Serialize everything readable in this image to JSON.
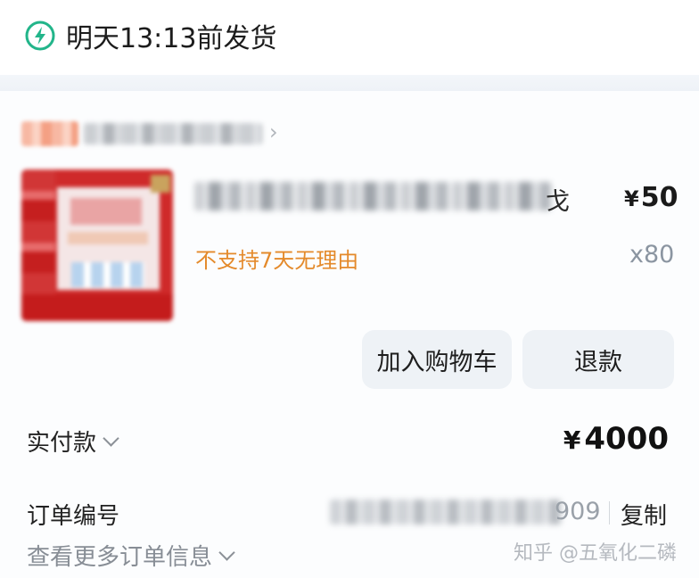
{
  "shipping": {
    "icon": "lightning-bolt-icon",
    "text": "明天13:13前发货",
    "icon_color": "#22b58a"
  },
  "shop": {
    "tag": "",
    "name": ""
  },
  "product": {
    "title_tail": "戈",
    "price_currency": "¥",
    "price": "50",
    "no_return": "不支持7天无理由",
    "quantity": "x80",
    "no_return_color": "#e48a2b"
  },
  "actions": {
    "add_to_cart": "加入购物车",
    "refund": "退款"
  },
  "payment": {
    "label": "实付款",
    "currency": "¥",
    "amount": "4000"
  },
  "order": {
    "label": "订单编号",
    "number_tail": "909",
    "copy": "复制"
  },
  "more": {
    "label": "查看更多订单信息"
  },
  "watermark": "知乎 @五氧化二磷"
}
